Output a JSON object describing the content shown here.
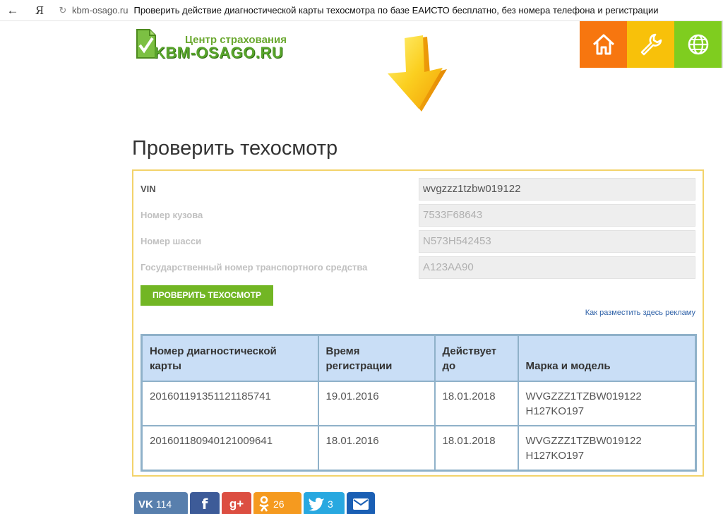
{
  "browser": {
    "back_glyph": "←",
    "ya_glyph": "Я",
    "reload_glyph": "↻",
    "domain": "kbm-osago.ru",
    "title": "Проверить действие диагностической карты техосмотра по базе ЕАИСТО бесплатно, без номера телефона и регистрации"
  },
  "header": {
    "logo_top": "Центр страхования",
    "logo_main": "KBM-OSAGO.RU",
    "tiles": [
      {
        "icon": "home-icon",
        "color": "#f7760f"
      },
      {
        "icon": "wrench-icon",
        "color": "#f8c10a"
      },
      {
        "icon": "globe-icon",
        "color": "#7fcd1f"
      }
    ]
  },
  "page_title": "Проверить техосмотр",
  "form": {
    "fields": [
      {
        "label": "VIN",
        "value": "wvgzzz1tzbw019122",
        "active": true
      },
      {
        "label": "Номер кузова",
        "placeholder": "7533F68643",
        "active": false
      },
      {
        "label": "Номер шасси",
        "placeholder": "N573H542453",
        "active": false
      },
      {
        "label": "Государственный номер транспортного средства",
        "placeholder": "A123AA90",
        "active": false
      }
    ],
    "submit_label": "ПРОВЕРИТЬ ТЕХОСМОТР",
    "ad_link": "Как разместить здесь рекламу"
  },
  "results": {
    "columns": [
      "Номер диагностической карты",
      "Время регистрации",
      "Действует до",
      "Марка и модель"
    ],
    "rows": [
      [
        "201601191351121185741",
        "19.01.2016",
        "18.01.2018",
        "WVGZZZ1TZBW019122 H127KO197"
      ],
      [
        "201601180940121009641",
        "18.01.2016",
        "18.01.2018",
        "WVGZZZ1TZBW019122 H127KO197"
      ]
    ]
  },
  "social": {
    "vk_count": "114",
    "ok_count": "26",
    "tw_count": "3",
    "gp_glyph": "g+",
    "fb_glyph": "f",
    "vk_glyph": "VK"
  }
}
